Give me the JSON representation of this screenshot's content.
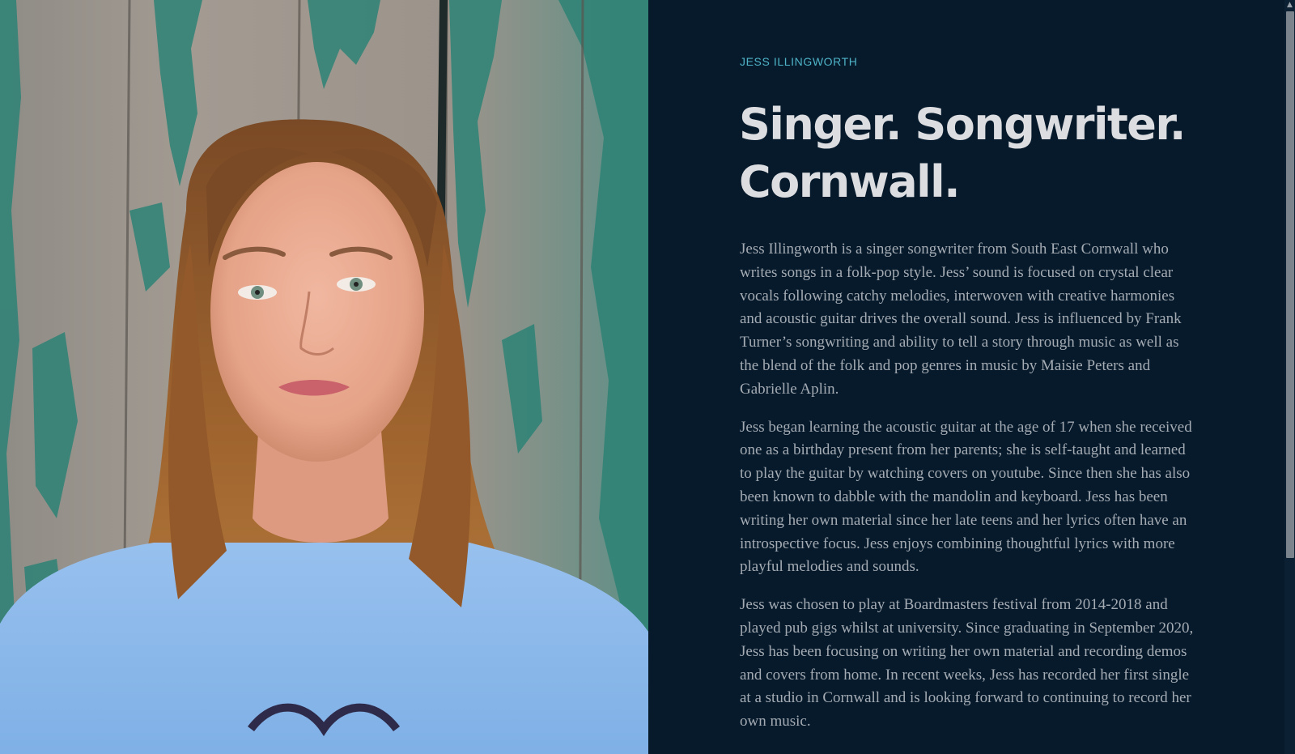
{
  "hero": {
    "image_alt": "Portrait of Jess Illingworth in front of weathered green wooden planks"
  },
  "intro": {
    "eyebrow": "JESS ILLINGWORTH",
    "headline_line1": "Singer. Songwriter.",
    "headline_line2": "Cornwall."
  },
  "bio": {
    "paragraphs": [
      "Jess Illingworth is a singer songwriter from South East Cornwall who writes songs in a folk-pop style. Jess’ sound is focused on crystal clear vocals following catchy melodies, interwoven with creative harmonies and acoustic guitar drives the overall sound. Jess is influenced by Frank Turner’s songwriting and ability to tell a story through music as well as the blend of the folk and pop genres in music by Maisie Peters and Gabrielle Aplin.",
      "Jess began learning the acoustic guitar at the age of 17 when she received one as a birthday present from her parents; she is self-taught and learned to play the guitar by watching covers on youtube. Since then she has also been known to dabble with the mandolin and keyboard. Jess has been writing her own material since her late teens and her lyrics often have an introspective focus. Jess enjoys combining thoughtful lyrics with more playful melodies and sounds.",
      "Jess was chosen to play at Boardmasters festival from 2014-2018 and played pub gigs whilst at university. Since graduating in September 2020, Jess has been focusing on writing her own material and recording demos and covers from home. In recent weeks, Jess has recorded her first single at a studio in Cornwall and is looking forward to continuing to record her own music."
    ]
  },
  "colors": {
    "background": "#061a2c",
    "accent": "#4fb3c7",
    "headline": "#dcdde0",
    "body_text": "#a4abb3"
  },
  "scrollbar": {
    "up_arrow_icon": "chevron-up-icon"
  }
}
